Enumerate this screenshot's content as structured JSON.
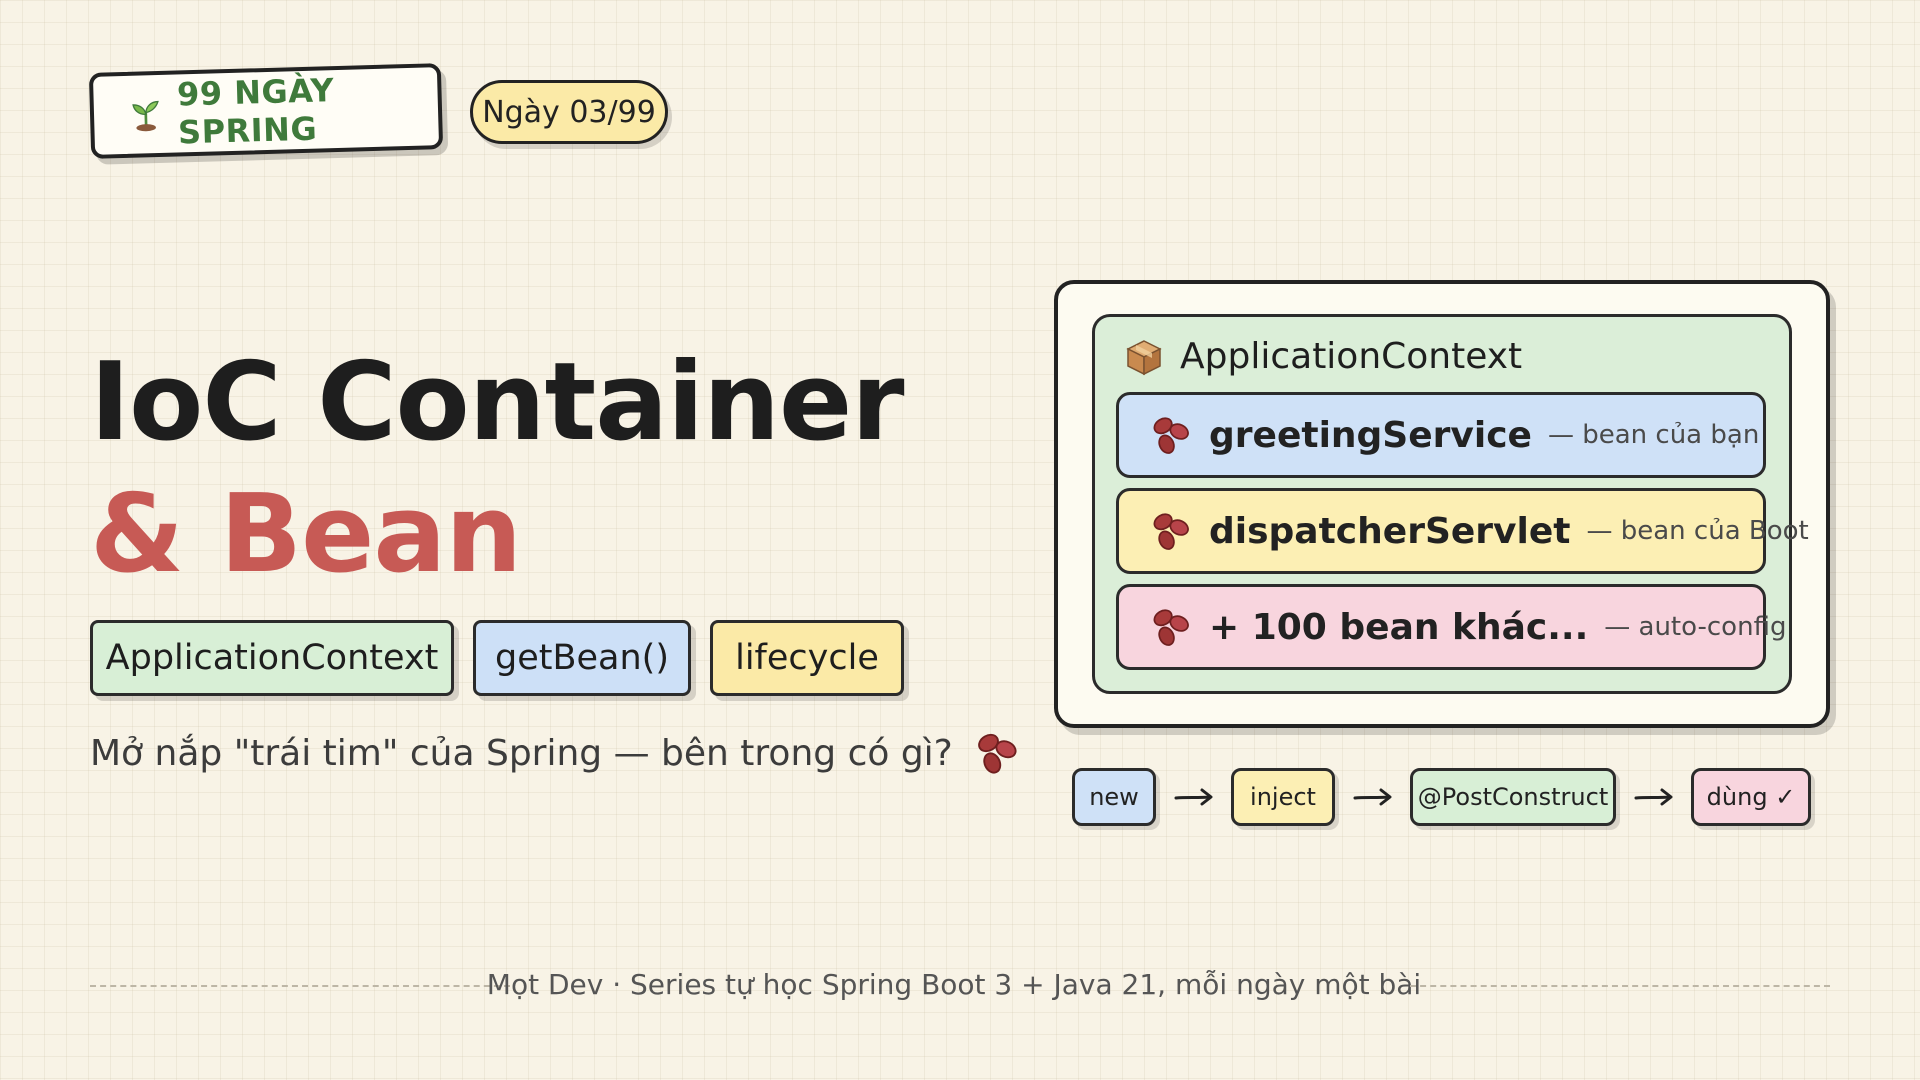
{
  "header": {
    "series_label": "99 NGÀY SPRING",
    "series_icon": "sprout-icon",
    "day_label": "Ngày 03/99"
  },
  "title": {
    "line1": "IoC Container",
    "line2": "& Bean"
  },
  "tags": [
    "ApplicationContext",
    "getBean()",
    "lifecycle"
  ],
  "subtitle": {
    "text": "Mở nắp \"trái tim\" của Spring — bên trong có gì?",
    "icon": "bean-icon"
  },
  "context": {
    "title": "ApplicationContext",
    "icon": "package-icon",
    "beans": [
      {
        "name": "greetingService",
        "note": "— bean của bạn",
        "color": "#cfe1f7"
      },
      {
        "name": "dispatcherServlet",
        "note": "— bean của Boot",
        "color": "#fcefb4"
      },
      {
        "name": "+ 100 bean khác...",
        "note": "— auto-config",
        "color": "#f8d5de"
      }
    ]
  },
  "lifecycle": [
    "new",
    "inject",
    "@PostConstruct",
    "dùng ✓"
  ],
  "footer": {
    "text": "Mọt Dev · Series tự học Spring Boot 3 + Java 21, mỗi ngày một bài"
  },
  "colors": {
    "background": "#f8f3e6",
    "accent_red": "#c75a55",
    "accent_green": "#3f7a3b",
    "blue": "#cfe1f7",
    "yellow": "#fcefb4",
    "green": "#d8efd6",
    "pink": "#f8d5de"
  }
}
